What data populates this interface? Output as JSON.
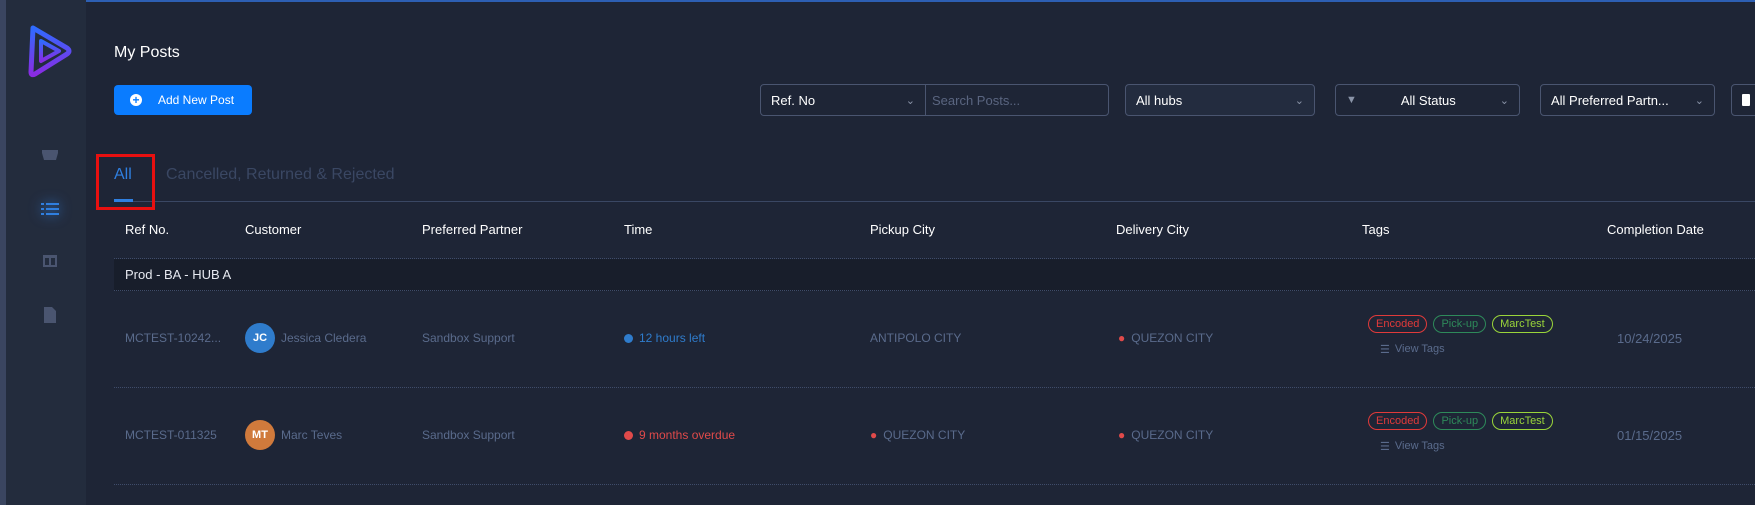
{
  "page": {
    "title": "My Posts",
    "add_button": "Add New Post"
  },
  "filters": {
    "ref_select": "Ref. No",
    "search_placeholder": "Search Posts...",
    "hubs": "All hubs",
    "status": "All Status",
    "partner": "All Preferred Partn..."
  },
  "tabs": [
    {
      "label": "All",
      "active": true
    },
    {
      "label": "Cancelled, Returned & Rejected",
      "active": false
    }
  ],
  "columns": [
    "Ref No.",
    "Customer",
    "Preferred Partner",
    "Time",
    "Pickup City",
    "Delivery City",
    "Tags",
    "Completion Date"
  ],
  "group": "Prod - BA - HUB A",
  "rows": [
    {
      "ref": "MCTEST-10242...",
      "initials": "JC",
      "avatar_color": "#2f7ccc",
      "customer": "Jessica Cledera",
      "partner": "Sandbox Support",
      "time": "12 hours left",
      "time_color": "#2f7ccc",
      "pickup": "ANTIPOLO CITY",
      "pickup_pin": false,
      "delivery": "QUEZON CITY",
      "tags": [
        "Encoded",
        "Pick-up",
        "MarcTest"
      ],
      "view_tags": "View Tags",
      "completion": "10/24/2025"
    },
    {
      "ref": "MCTEST-011325",
      "initials": "MT",
      "avatar_color": "#d07a3c",
      "customer": "Marc Teves",
      "partner": "Sandbox Support",
      "time": "9 months overdue",
      "time_color": "#e04a4a",
      "pickup": "QUEZON CITY",
      "pickup_pin": true,
      "delivery": "QUEZON CITY",
      "tags": [
        "Encoded",
        "Pick-up",
        "MarcTest"
      ],
      "view_tags": "View Tags",
      "completion": "01/15/2025"
    }
  ],
  "tag_colors": {
    "Encoded": "#e03a3a",
    "Pick-up": "#2e8a5a",
    "MarcTest": "#9ad53a"
  }
}
